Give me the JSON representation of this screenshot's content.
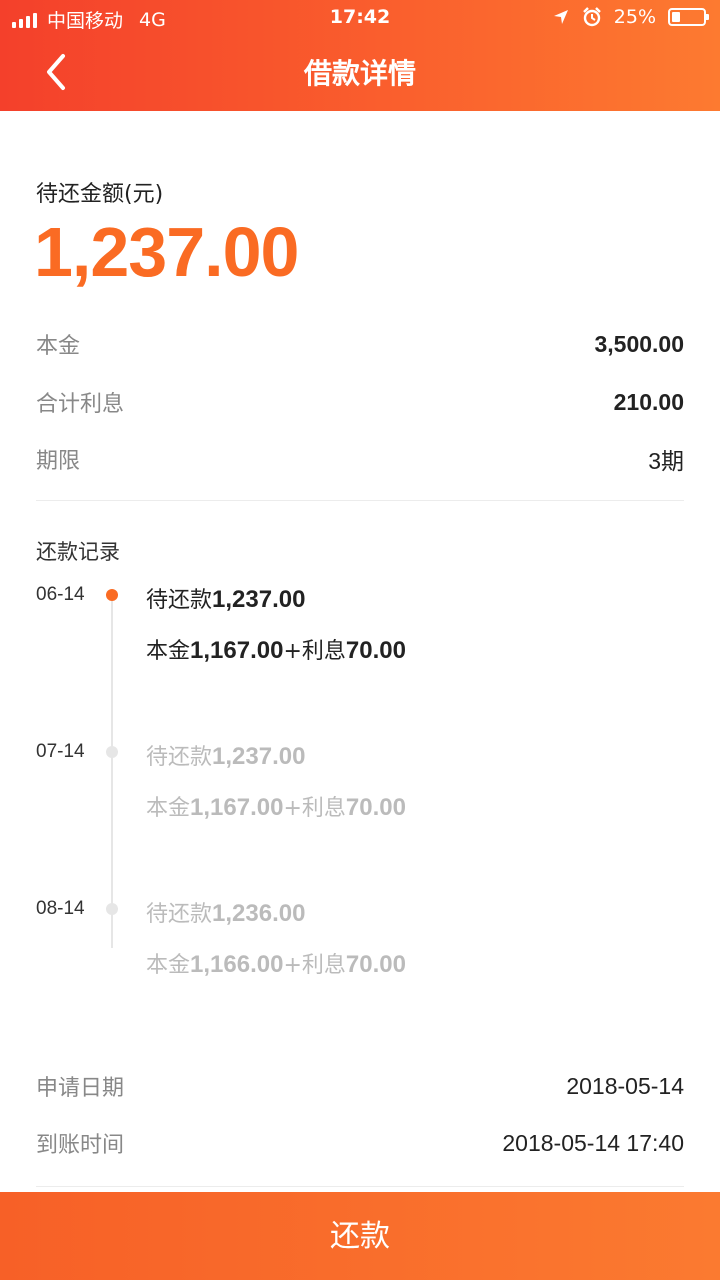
{
  "status_bar": {
    "carrier": "中国移动",
    "network": "4G",
    "time": "17:42",
    "battery": "25%",
    "battery_level": 0.25
  },
  "nav": {
    "title": "借款详情"
  },
  "summary": {
    "amount_label": "待还金额(元)",
    "amount_value": "1,237.00",
    "rows": [
      {
        "label": "本金",
        "value": "3,500.00"
      },
      {
        "label": "合计利息",
        "value": "210.00"
      },
      {
        "label": "期限",
        "value": "3期"
      }
    ]
  },
  "records": {
    "title": "还款记录",
    "items": [
      {
        "date": "06-14",
        "due_prefix": "待还款",
        "due_amount": "1,237.00",
        "principal_prefix": "本金",
        "principal": "1,167.00",
        "interest_prefix": "+利息",
        "interest": "70.00"
      },
      {
        "date": "07-14",
        "due_prefix": "待还款",
        "due_amount": "1,237.00",
        "principal_prefix": "本金",
        "principal": "1,167.00",
        "interest_prefix": "+利息",
        "interest": "70.00"
      },
      {
        "date": "08-14",
        "due_prefix": "待还款",
        "due_amount": "1,236.00",
        "principal_prefix": "本金",
        "principal": "1,166.00",
        "interest_prefix": "+利息",
        "interest": "70.00"
      }
    ]
  },
  "info": {
    "rows": [
      {
        "label": "申请日期",
        "value": "2018-05-14"
      },
      {
        "label": "到账时间",
        "value": "2018-05-14 17:40"
      }
    ]
  },
  "footer": {
    "pay_label": "还款"
  },
  "colors": {
    "accent": "#fa6b23",
    "header_start": "#f4402b",
    "header_end": "#fd7a30"
  },
  "icons": {
    "back": "chevron-left-icon",
    "location": "location-arrow-icon",
    "alarm": "alarm-clock-icon"
  }
}
